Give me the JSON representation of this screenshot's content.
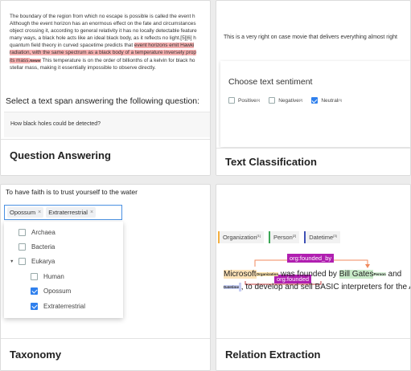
{
  "qa": {
    "passage_lines": [
      "The boundary of the region from which no escape is possible is called the event h",
      "Although the event horizon has an enormous effect on the fate and circumstances",
      "object crossing it, according to general relativity it has no locally detectable feature",
      "many ways, a black hole acts like an ideal black body, as it reflects no light.[5][6] h",
      "quantum field theory in curved spacetime predicts that"
    ],
    "passage_highlight_start": "event horizons emit Hawki",
    "highlight_lines": [
      "radiation, with the same spectrum as a black body of a temperature inversely prop",
      "its mass."
    ],
    "highlight_tag": "Newer",
    "passage_after": " This temperature is on the order of billionths of a kelvin for black ho",
    "passage_last": "stellar mass, making it essentially impossible to observe directly.",
    "question_prompt": "Select a text span answering the following question:",
    "question": "How black holes could be detected?",
    "title": "Question Answering"
  },
  "tc": {
    "text": "This is a very right on case movie that delivers everything almost right",
    "prompt": "Choose text sentiment",
    "options": [
      {
        "label": "Positive",
        "key": "[1]",
        "checked": false
      },
      {
        "label": "Negative",
        "key": "[2]",
        "checked": false
      },
      {
        "label": "Neutral",
        "key": "[3]",
        "checked": true
      }
    ],
    "title": "Text Classification"
  },
  "tax": {
    "text": "To have faith is to trust yourself to the water",
    "chips": [
      "Opossum",
      "Extraterrestrial"
    ],
    "chip_close": "×",
    "clear": "×",
    "tree": [
      {
        "label": "Archaea",
        "checked": false
      },
      {
        "label": "Bacteria",
        "checked": false
      },
      {
        "label": "Eukarya",
        "checked": false
      },
      {
        "label": "Human",
        "checked": false
      },
      {
        "label": "Opossum",
        "checked": true
      },
      {
        "label": "Extraterrestrial",
        "checked": true
      }
    ],
    "caret": "▼",
    "title": "Taxonomy"
  },
  "re": {
    "labels": [
      {
        "label": "Organization",
        "key": "[1]"
      },
      {
        "label": "Person",
        "key": "[2]"
      },
      {
        "label": "Datetime",
        "key": "[3]"
      }
    ],
    "relation_top": "org:founded_by",
    "relation_bottom": "org:founded",
    "sentence": {
      "ent1": "Microsoft",
      "ent1_tag": "Organization",
      "mid1": " was founded by ",
      "ent2": "Bill Gates",
      "ent2_tag": "Person",
      "mid2": " and",
      "ent3_tag": "Datetime",
      "mid3": ", to develop and sell BASIC interpreters for the A"
    },
    "title": "Relation Extraction"
  },
  "colors": {
    "highlight": "#f7b1b1",
    "checkbox_checked": "#2f80ed",
    "relation": "#b01fb0",
    "org": "#f5b041",
    "person": "#3aa655",
    "datetime": "#3f51b5"
  }
}
